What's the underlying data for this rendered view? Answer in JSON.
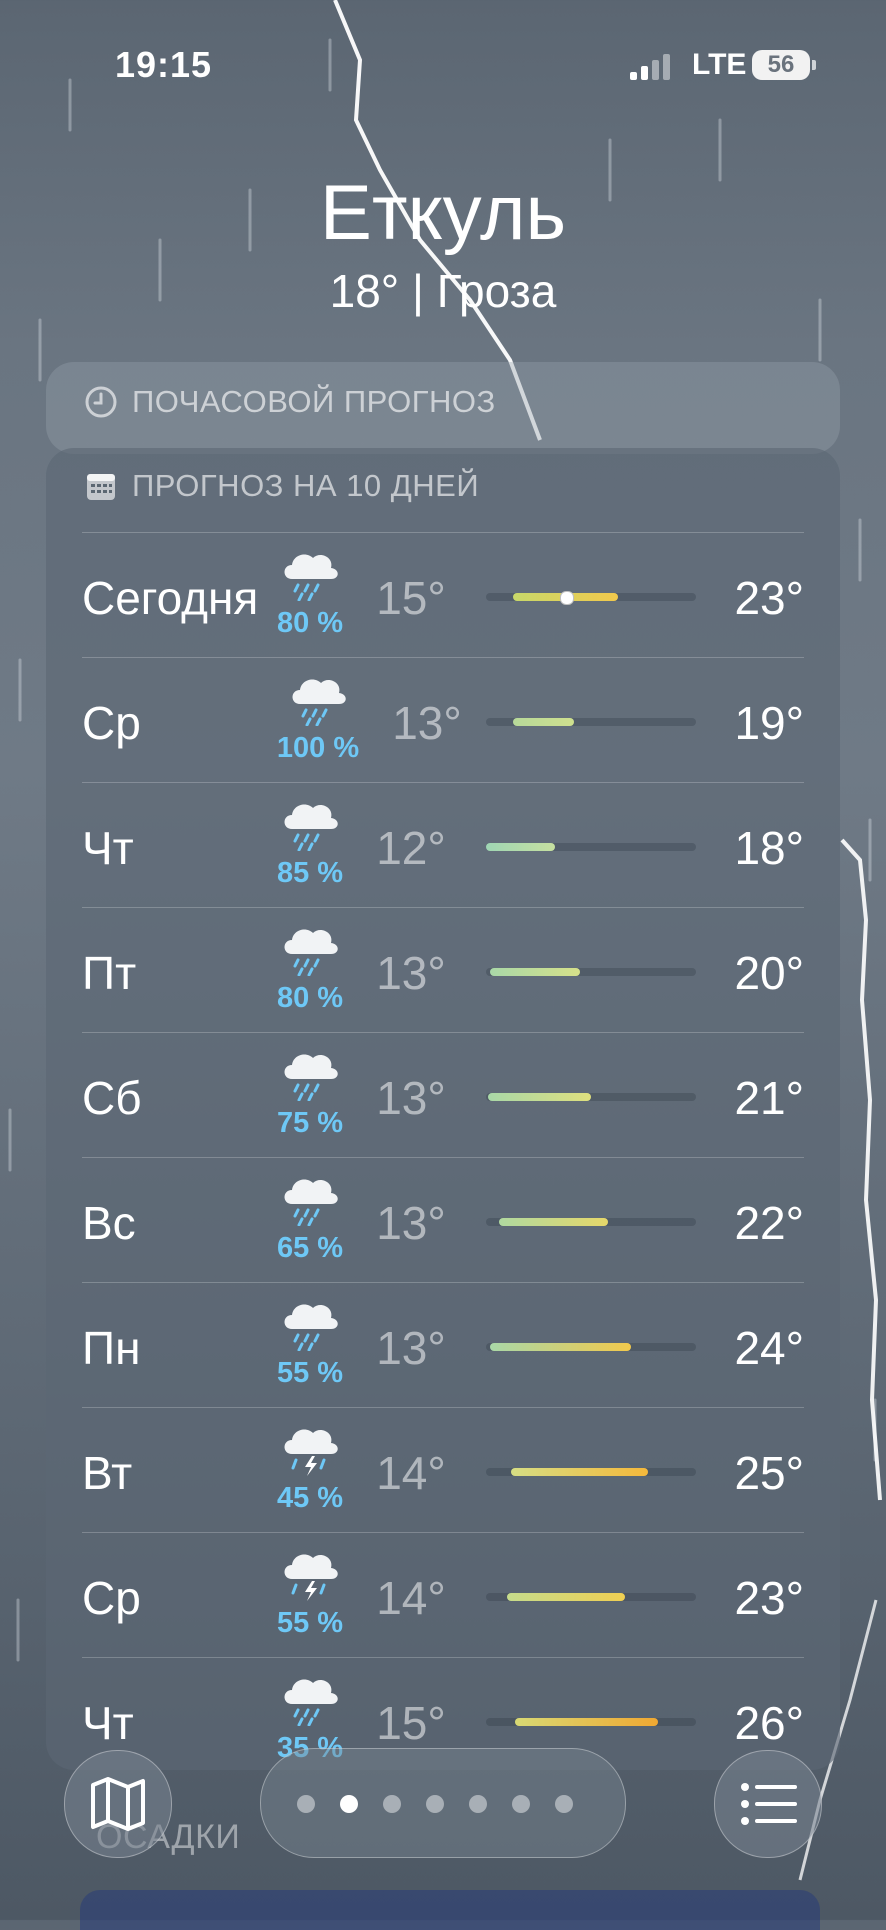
{
  "status_bar": {
    "time": "19:15",
    "network": "LTE",
    "battery": "56"
  },
  "location": {
    "city": "Еткуль",
    "summary": "18° | Гроза"
  },
  "hourly_card": {
    "title": "ПОЧАСОВОЙ ПРОГНОЗ",
    "icon": "clock-icon"
  },
  "forecast_card": {
    "title": "ПРОГНОЗ НА 10 ДНЕЙ",
    "icon": "calendar-icon",
    "days": [
      {
        "day": "Сегодня",
        "precip": "80 %",
        "low": "15°",
        "high": "23°",
        "icon": "rain-cloud-icon",
        "bar_start": 0.13,
        "bar_end": 0.63,
        "current": 0.38,
        "gradient": [
          "#c8d86a",
          "#f2c94c"
        ]
      },
      {
        "day": "Ср",
        "precip": "100 %",
        "low": "13°",
        "high": "19°",
        "icon": "rain-cloud-icon",
        "bar_start": 0.13,
        "bar_end": 0.42,
        "gradient": [
          "#b7d99a",
          "#cfe08e"
        ]
      },
      {
        "day": "Чт",
        "precip": "85 %",
        "low": "12°",
        "high": "18°",
        "icon": "rain-cloud-icon",
        "bar_start": 0.0,
        "bar_end": 0.33,
        "gradient": [
          "#9fd6b4",
          "#c6e0a0"
        ]
      },
      {
        "day": "Пт",
        "precip": "80 %",
        "low": "13°",
        "high": "20°",
        "icon": "rain-cloud-icon",
        "bar_start": 0.02,
        "bar_end": 0.45,
        "gradient": [
          "#a9d8a8",
          "#d6e18a"
        ]
      },
      {
        "day": "Сб",
        "precip": "75 %",
        "low": "13°",
        "high": "21°",
        "icon": "rain-cloud-icon",
        "bar_start": 0.01,
        "bar_end": 0.5,
        "gradient": [
          "#a9d8a8",
          "#dfe07e"
        ]
      },
      {
        "day": "Вс",
        "precip": "65 %",
        "low": "13°",
        "high": "22°",
        "icon": "rain-cloud-icon",
        "bar_start": 0.06,
        "bar_end": 0.58,
        "gradient": [
          "#b0d9a0",
          "#e6d86a"
        ]
      },
      {
        "day": "Пн",
        "precip": "55 %",
        "low": "13°",
        "high": "24°",
        "icon": "rain-cloud-icon",
        "bar_start": 0.02,
        "bar_end": 0.69,
        "gradient": [
          "#a9d8a8",
          "#f2c94c"
        ]
      },
      {
        "day": "Вт",
        "precip": "45 %",
        "low": "14°",
        "high": "25°",
        "icon": "thunderstorm-icon",
        "bar_start": 0.12,
        "bar_end": 0.77,
        "gradient": [
          "#d6de84",
          "#f5b93b"
        ]
      },
      {
        "day": "Ср",
        "precip": "55 %",
        "low": "14°",
        "high": "23°",
        "icon": "thunderstorm-icon",
        "bar_start": 0.1,
        "bar_end": 0.66,
        "gradient": [
          "#c6dc8c",
          "#f0cf52"
        ]
      },
      {
        "day": "Чт",
        "precip": "35 %",
        "low": "15°",
        "high": "26°",
        "icon": "rain-cloud-icon",
        "bar_start": 0.14,
        "bar_end": 0.82,
        "gradient": [
          "#d8d974",
          "#f0a832"
        ]
      }
    ]
  },
  "next_card_partial": "ОСАДКИ",
  "bottom_bar": {
    "map_icon": "map-icon",
    "list_icon": "list-icon",
    "page_count": 7,
    "active_page": 1
  }
}
